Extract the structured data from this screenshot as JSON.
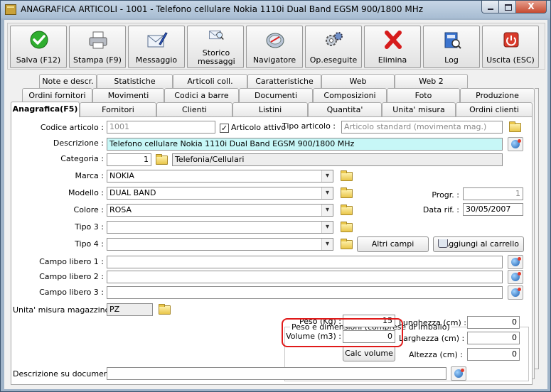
{
  "window": {
    "title": "ANAGRAFICA ARTICOLI - 1001 - Telefono cellulare Nokia 1110i Dual Band EGSM 900/1800 MHz",
    "close_glyph": "X"
  },
  "toolbar": [
    {
      "label": "Salva (F12)",
      "icon": "check-icon"
    },
    {
      "label": "Stampa (F9)",
      "icon": "printer-icon"
    },
    {
      "label": "Messaggio",
      "icon": "envelope-pen-icon"
    },
    {
      "label": "Storico messaggi",
      "icon": "envelope-search-icon"
    },
    {
      "label": "Navigatore",
      "icon": "compass-icon"
    },
    {
      "label": "Op.eseguite",
      "icon": "gears-icon"
    },
    {
      "label": "Elimina",
      "icon": "red-x-icon"
    },
    {
      "label": "Log",
      "icon": "log-book-icon"
    },
    {
      "label": "Uscita (ESC)",
      "icon": "power-icon"
    }
  ],
  "tabs": {
    "row1": [
      "Note e descr.",
      "Statistiche",
      "Articoli coll.",
      "Caratteristiche",
      "Web",
      "Web 2"
    ],
    "row2": [
      "Ordini fornitori",
      "Movimenti",
      "Codici a barre",
      "Documenti",
      "Composizioni",
      "Foto",
      "Produzione"
    ],
    "row3": [
      "Anagrafica(F5)",
      "Fornitori",
      "Clienti",
      "Listini",
      "Quantita'",
      "Unita' misura",
      "Ordini clienti"
    ]
  },
  "form": {
    "codice_label": "Codice articolo :",
    "codice_value": "1001",
    "attivo_label": "Articolo attivo",
    "attivo_check": "✓",
    "tipo_label": "Tipo articolo :",
    "tipo_value": "Articolo standard (movimenta mag.)",
    "descr_label": "Descrizione :",
    "descr_value": "Telefono cellulare Nokia 1110i Dual Band EGSM 900/1800 MHz",
    "categoria_label": "Categoria :",
    "categoria_value": "1",
    "categoria_name": "Telefonia/Cellulari",
    "marca_label": "Marca :",
    "marca_value": "NOKIA",
    "modello_label": "Modello :",
    "modello_value": "DUAL BAND",
    "colore_label": "Colore :",
    "colore_value": "ROSA",
    "tipo3_label": "Tipo 3 :",
    "tipo3_value": "",
    "tipo4_label": "Tipo 4 :",
    "tipo4_value": "",
    "progr_label": "Progr. :",
    "progr_value": "1",
    "datarif_label": "Data rif. :",
    "datarif_value": "30/05/2007",
    "altri_campi": "Altri campi",
    "aggiungi_carrello": "Aggiungi al carrello",
    "campo1_label": "Campo libero 1 :",
    "campo2_label": "Campo libero 2 :",
    "campo3_label": "Campo libero 3 :",
    "um_label": "Unita' misura magazzino :",
    "um_value": "PZ",
    "group_title": "Peso e dimensioni (comprese di imballo)",
    "peso_label": "Peso (Kg) :",
    "peso_value": "15",
    "volume_label": "Volume (m3) :",
    "volume_value": "0",
    "calc_volume": "Calc volume",
    "lunghezza_label": "Lunghezza (cm) :",
    "lunghezza_value": "0",
    "larghezza_label": "Larghezza (cm) :",
    "larghezza_value": "0",
    "altezza_label": "Altezza (cm) :",
    "altezza_value": "0",
    "descr_doc_label": "Descrizione su documenti :",
    "descr_doc_value": ""
  }
}
